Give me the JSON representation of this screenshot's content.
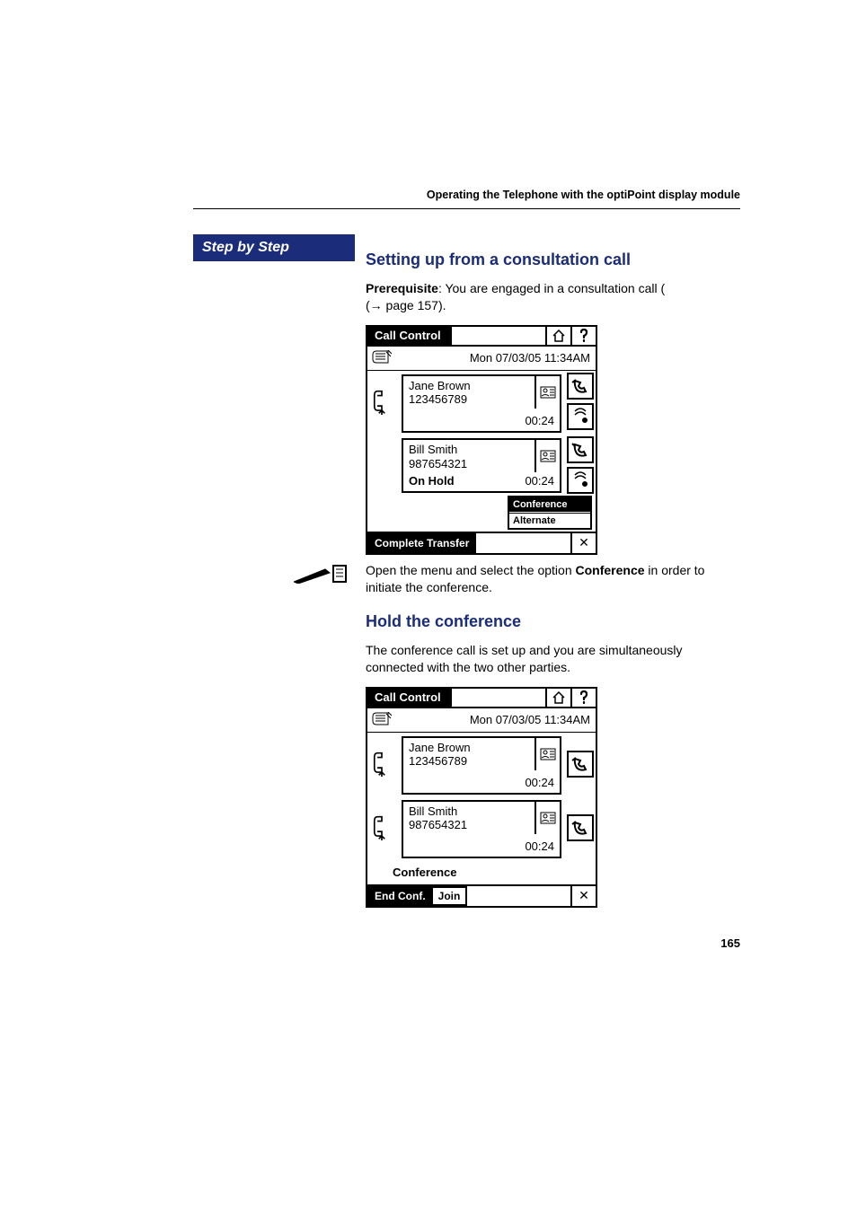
{
  "header": "Operating the Telephone with the optiPoint display module",
  "stepByStep": "Step by Step",
  "section1": {
    "title": "Setting up from a consultation call",
    "prereq_label": "Prerequisite",
    "prereq_text": ": You are engaged in a consultation call (",
    "prereq_arrow": "→ page 157).",
    "instruction_pre": "Open the menu and select the option ",
    "instruction_bold": "Conference",
    "instruction_post": " in order to initiate the conference."
  },
  "section2": {
    "title": "Hold the conference",
    "body": "The conference call is set up and you are simultaneously connected with the two other parties."
  },
  "phone1": {
    "header": "Call Control",
    "date": "Mon 07/03/05 11:34AM",
    "caller1_name": "Jane Brown",
    "caller1_num": "123456789",
    "caller1_timer": "00:24",
    "caller2_name": "Bill Smith",
    "caller2_num": "987654321",
    "caller2_status": "On Hold",
    "caller2_timer": "00:24",
    "menu_item1": "Conference",
    "menu_item2": "Alternate",
    "bottom_btn": "Complete Transfer"
  },
  "phone2": {
    "header": "Call Control",
    "date": "Mon 07/03/05 11:34AM",
    "caller1_name": "Jane Brown",
    "caller1_num": "123456789",
    "caller1_timer": "00:24",
    "caller2_name": "Bill Smith",
    "caller2_num": "987654321",
    "caller2_timer": "00:24",
    "conf_label": "Conference",
    "bottom_btn1": "End Conf.",
    "bottom_btn2": "Join"
  },
  "icons": {
    "home": "home-icon",
    "help": "help-icon",
    "notepad": "notepad-icon",
    "phone_handset": "phone-handset-icon",
    "contact_card": "contact-card-icon",
    "handset_hold": "handset-hold-icon",
    "handset_active": "handset-active-icon",
    "record_dot": "record-icon",
    "close_x": "✕",
    "pen": "pen-icon",
    "arrow": "→"
  },
  "pageNum": "165"
}
